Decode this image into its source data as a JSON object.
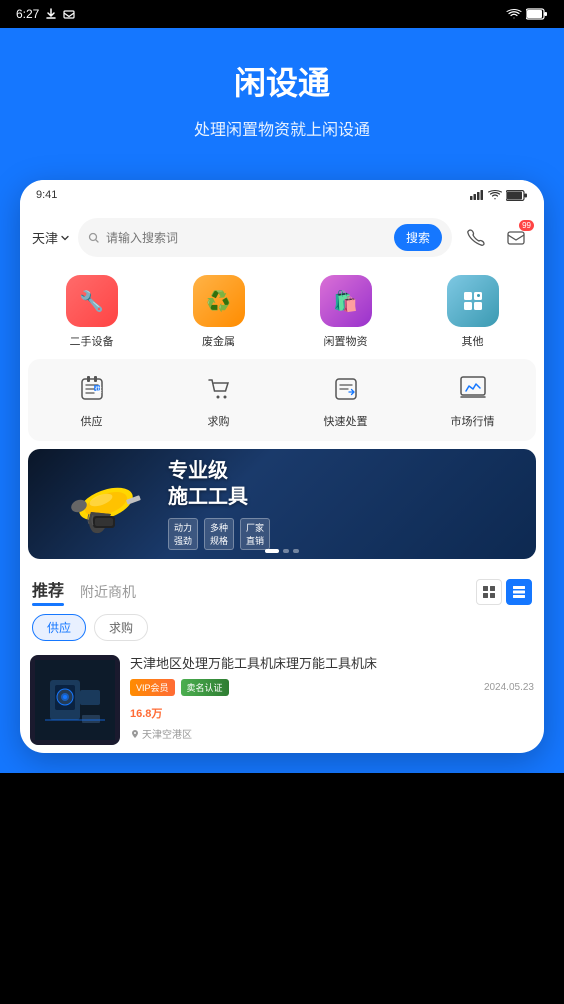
{
  "statusBar": {
    "time": "6:27",
    "batteryIcon": "battery",
    "wifiIcon": "wifi",
    "signalIcon": "signal"
  },
  "header": {
    "title": "闲设通",
    "subtitle": "处理闲置物资就上闲设通"
  },
  "phone": {
    "statusTime": "9:41",
    "location": "天津",
    "searchPlaceholder": "请输入搜索词",
    "searchBtnLabel": "搜索",
    "msgBadge": "99",
    "categories": [
      {
        "label": "二手设备",
        "emoji": "🔧",
        "colorClass": "red"
      },
      {
        "label": "废金属",
        "emoji": "♻️",
        "colorClass": "orange"
      },
      {
        "label": "闲置物资",
        "emoji": "🛍️",
        "colorClass": "purple"
      },
      {
        "label": "其他",
        "emoji": "⊞",
        "colorClass": "teal"
      }
    ],
    "quickActions": [
      {
        "label": "供应",
        "emoji": "📋"
      },
      {
        "label": "求购",
        "emoji": "🛒"
      },
      {
        "label": "快速处置",
        "emoji": "📝"
      },
      {
        "label": "市场行情",
        "emoji": "📈"
      }
    ],
    "banner": {
      "mainText": "专业级\n施工工具",
      "tags": [
        "动力\n强劲",
        "多种\n规格",
        "厂家\n直销"
      ]
    },
    "tabs": [
      {
        "label": "推荐",
        "active": true
      },
      {
        "label": "附近商机",
        "active": false
      }
    ],
    "filters": [
      {
        "label": "供应",
        "active": true
      },
      {
        "label": "求购",
        "active": false
      }
    ],
    "product": {
      "title": "天津地区处理万能工具机床理万能工具机床",
      "vipBadge": "VIP会员",
      "authBadge": "卖名认证",
      "date": "2024.05.23",
      "price": "16.8万",
      "priceUnit": "",
      "location": "天津空港区"
    }
  }
}
